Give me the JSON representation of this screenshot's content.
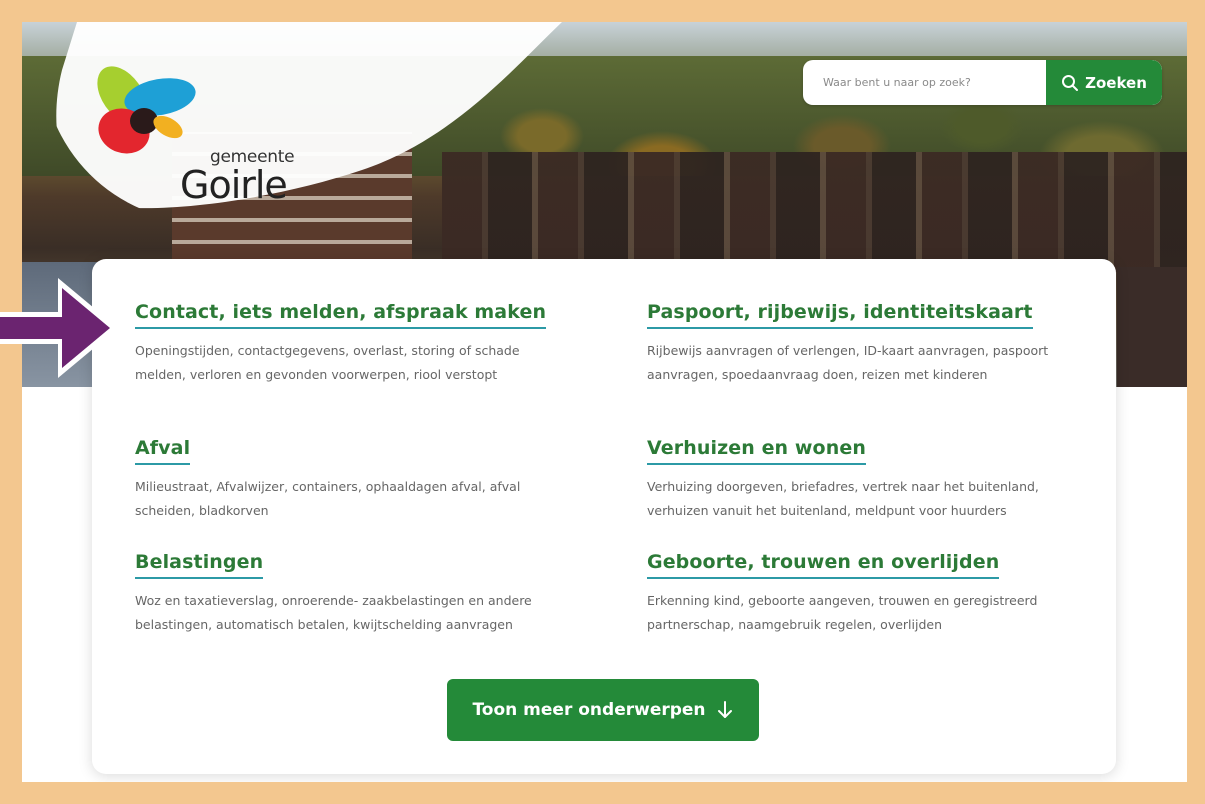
{
  "logo": {
    "small_text": "gemeente",
    "big_text": "Goirle"
  },
  "search": {
    "placeholder": "Waar bent u naar op zoek?",
    "button_label": "Zoeken"
  },
  "topics": [
    {
      "title": "Contact, iets melden, afspraak maken",
      "description": "Openingstijden, contactgegevens, overlast, storing of schade melden, verloren en gevonden voorwerpen, riool verstopt"
    },
    {
      "title": "Paspoort, rijbewijs, identiteitskaart",
      "description": "Rijbewijs aanvragen of verlengen, ID-kaart aanvragen, paspoort aanvragen, spoedaanvraag doen, reizen met kinderen"
    },
    {
      "title": "Afval",
      "description": "Milieustraat, Afvalwijzer, containers, ophaaldagen afval, afval scheiden, bladkorven"
    },
    {
      "title": "Verhuizen en wonen",
      "description": "Verhuizing doorgeven, briefadres, vertrek naar het buitenland, verhuizen vanuit het buitenland, meldpunt voor huurders"
    },
    {
      "title": "Belastingen",
      "description": "Woz en taxatieverslag, onroerende- zaakbelastingen en andere belastingen, automatisch betalen, kwijtschelding aanvragen"
    },
    {
      "title": "Geboorte, trouwen en overlijden",
      "description": "Erkenning kind, geboorte aangeven, trouwen en geregistreerd partnerschap, naamgebruik regelen, overlijden"
    }
  ],
  "more_button": {
    "label": "Toon meer onderwerpen"
  },
  "colors": {
    "frame": "#f3c78f",
    "brand_green": "#248a39",
    "title_green": "#2c7a37",
    "underline_teal": "#2c9aa6",
    "arrow_purple": "#6b2470"
  },
  "icons": {
    "search": "magnifier-icon",
    "more": "arrow-down-icon",
    "pointer": "arrow-right-icon"
  }
}
